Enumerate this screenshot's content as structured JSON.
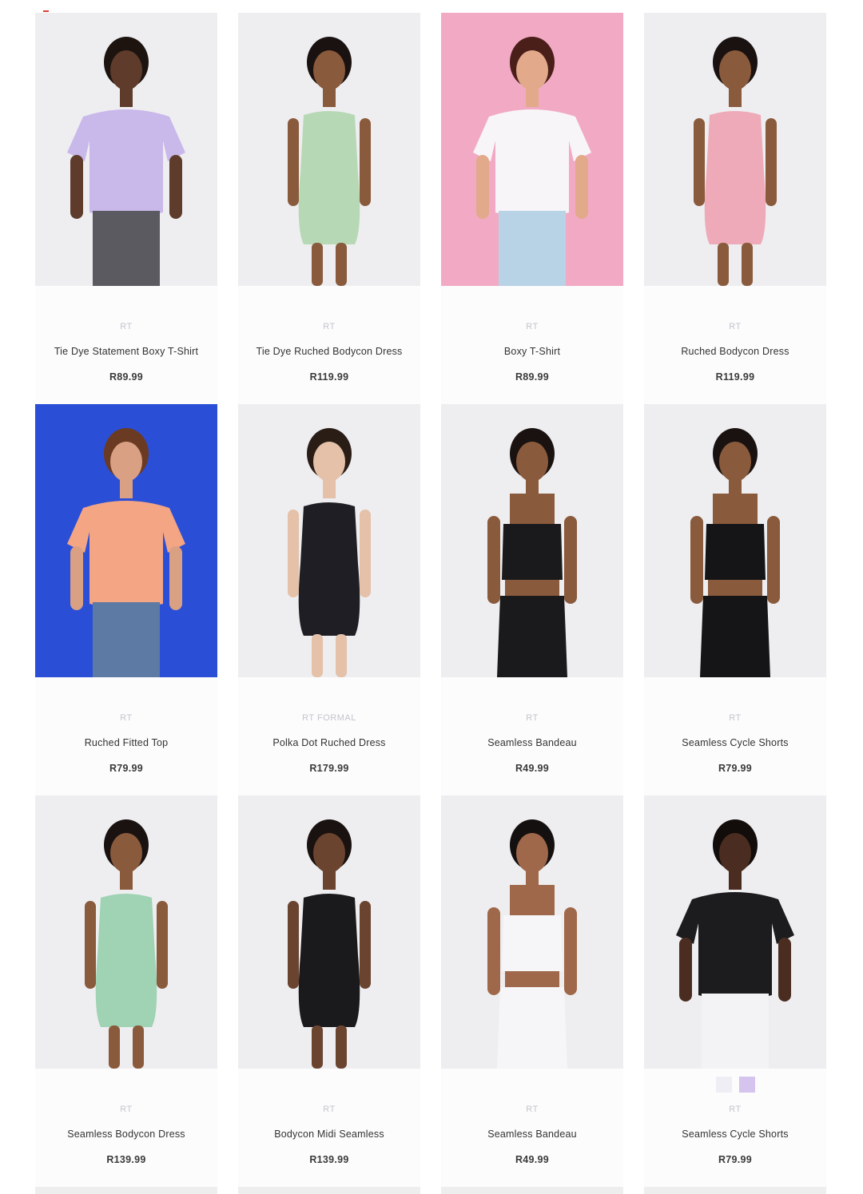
{
  "header": {
    "flag_icon": "south-africa-flag-icon"
  },
  "products": [
    {
      "brand": "RT",
      "name": "Tie Dye Statement Boxy T-Shirt",
      "price": "R89.99",
      "bg": "#eeeef1",
      "garment": "#c9b8ea",
      "skin": "#5e3b2b",
      "hair": "#1d1410",
      "bottom": "#5a5a60",
      "style": "tee"
    },
    {
      "brand": "RT",
      "name": "Tie Dye Ruched Bodycon Dress",
      "price": "R119.99",
      "bg": "#eeeef1",
      "garment": "#b7d8b5",
      "skin": "#8a5a3c",
      "hair": "#1a1210",
      "bottom": "#b7d8b5",
      "style": "dress"
    },
    {
      "brand": "RT",
      "name": "Boxy T-Shirt",
      "price": "R89.99",
      "bg": "#f2aac4",
      "garment": "#f7f5f7",
      "skin": "#e2a98a",
      "hair": "#4a1f1a",
      "bottom": "#b8d2e6",
      "style": "tee"
    },
    {
      "brand": "RT",
      "name": "Ruched Bodycon Dress",
      "price": "R119.99",
      "bg": "#eeeef1",
      "garment": "#eeaab8",
      "skin": "#8a5a3c",
      "hair": "#1a1210",
      "bottom": "#eeaab8",
      "style": "dress"
    },
    {
      "brand": "RT",
      "name": "Ruched Fitted Top",
      "price": "R79.99",
      "bg": "#2a4fd6",
      "garment": "#f3a584",
      "skin": "#d9a083",
      "hair": "#6b3a22",
      "bottom": "#5c7aa3",
      "style": "tee"
    },
    {
      "brand": "RT FORMAL",
      "name": "Polka Dot Ruched Dress",
      "price": "R179.99",
      "bg": "#eeeef1",
      "garment": "#1e1e24",
      "skin": "#e4c1a8",
      "hair": "#2a1d16",
      "bottom": "#1e1e24",
      "style": "dress"
    },
    {
      "brand": "RT",
      "name": "Seamless Bandeau",
      "price": "R49.99",
      "bg": "#eeeef1",
      "garment": "#1a1a1d",
      "skin": "#8a5a3c",
      "hair": "#1a1210",
      "bottom": "#1a1a1d",
      "style": "bandeau"
    },
    {
      "brand": "RT",
      "name": "Seamless Cycle Shorts",
      "price": "R79.99",
      "bg": "#eeeef1",
      "garment": "#151518",
      "skin": "#8a5a3c",
      "hair": "#1a1210",
      "bottom": "#151518",
      "style": "bandeau"
    },
    {
      "brand": "RT",
      "name": "Seamless Bodycon Dress",
      "price": "R139.99",
      "bg": "#eeeef1",
      "garment": "#9fd3b3",
      "skin": "#8a5a3c",
      "hair": "#1a1210",
      "bottom": "#9fd3b3",
      "style": "dress"
    },
    {
      "brand": "RT",
      "name": "Bodycon Midi Seamless",
      "price": "R139.99",
      "bg": "#eeeef1",
      "garment": "#1a1a1d",
      "skin": "#6b4430",
      "hair": "#1a1210",
      "bottom": "#1a1a1d",
      "style": "dress"
    },
    {
      "brand": "RT",
      "name": "Seamless Bandeau",
      "price": "R49.99",
      "bg": "#eeeef1",
      "garment": "#f6f6f8",
      "skin": "#a0684a",
      "hair": "#151010",
      "bottom": "#f6f6f8",
      "style": "bandeau"
    },
    {
      "brand": "RT",
      "name": "Seamless Cycle Shorts",
      "price": "R79.99",
      "bg": "#eeeef1",
      "garment": "#1c1c1f",
      "skin": "#4a2d20",
      "hair": "#120c0a",
      "bottom": "#f3f3f5",
      "style": "tee",
      "swatches": [
        "#f0eef5",
        "#d4c4ee"
      ]
    }
  ]
}
